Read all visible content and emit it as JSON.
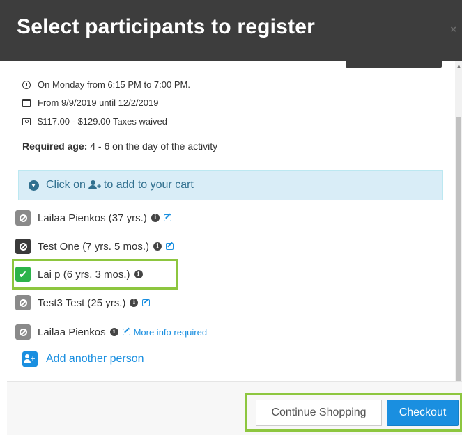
{
  "modal": {
    "title": "Select participants to register",
    "close_glyph": "×"
  },
  "activity": {
    "schedule": "On Monday from 6:15 PM to 7:00 PM.",
    "dates": "From 9/9/2019 until 12/2/2019",
    "price": "$117.00 - $129.00 Taxes waived",
    "age_label": "Required age:",
    "age_value": " 4 - 6 on the day of the activity"
  },
  "notice": {
    "text_before": "Click on",
    "text_after": "to add to your cart"
  },
  "participants": [
    {
      "name": "Lailaa Pienkos (37 yrs.)",
      "status": "not-eligible",
      "has_info": true,
      "has_edit": true
    },
    {
      "name": "Test One (7 yrs. 5 mos.)",
      "status": "not-eligible-dark",
      "has_info": true,
      "has_edit": true
    },
    {
      "name": "Lai p (6 yrs. 3 mos.)",
      "status": "selected",
      "has_info": true,
      "has_edit": false
    },
    {
      "name": "Test3 Test (25 yrs.)",
      "status": "not-eligible",
      "has_info": true,
      "has_edit": true
    },
    {
      "name": "Lailaa Pienkos",
      "status": "not-eligible",
      "has_info": true,
      "has_edit": true,
      "extra_link": "More info required"
    }
  ],
  "add_person_label": "Add another person",
  "footer": {
    "continue_label": "Continue Shopping",
    "checkout_label": "Checkout"
  },
  "colors": {
    "header_bg": "#3d3d3d",
    "notice_bg": "#d9edf7",
    "notice_text": "#31708f",
    "link_blue": "#1a8fe0",
    "selected_green": "#2cb34a",
    "highlight_green": "#8dc63f",
    "disabled_gray": "#8a8a8a"
  }
}
